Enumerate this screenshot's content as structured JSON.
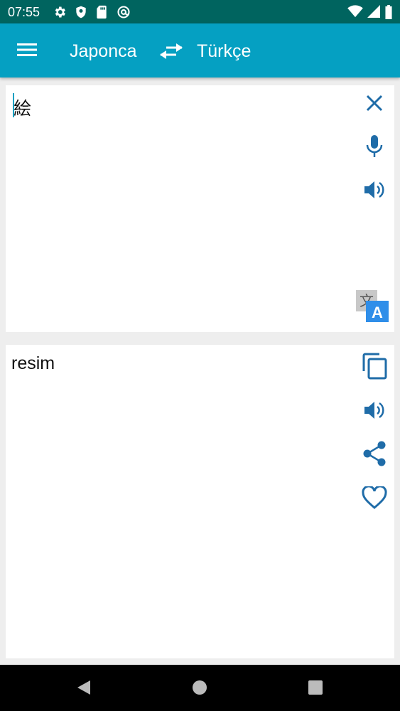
{
  "status_bar": {
    "time": "07:55",
    "left_icons": [
      "settings-icon",
      "shield-icon",
      "sd-card-icon",
      "at-sign-icon"
    ],
    "right_icons": [
      "wifi-icon",
      "signal-icon",
      "battery-icon"
    ]
  },
  "app_bar": {
    "source_language": "Japonca",
    "target_language": "Türkçe",
    "menu_icon": "hamburger-menu-icon",
    "swap_icon": "swap-arrows-icon"
  },
  "input": {
    "text": "絵",
    "actions": [
      "clear",
      "microphone",
      "speak",
      "translate"
    ]
  },
  "output": {
    "text": "resim",
    "actions": [
      "copy",
      "speak",
      "share",
      "favorite"
    ]
  },
  "colors": {
    "status_bar": "#00645f",
    "app_bar": "#05a0c2",
    "icon": "#1f6ca8",
    "translate_badge": "#2f8ee9",
    "background": "#eeeeee"
  },
  "nav_bar": {
    "buttons": [
      "back",
      "home",
      "recents"
    ]
  }
}
